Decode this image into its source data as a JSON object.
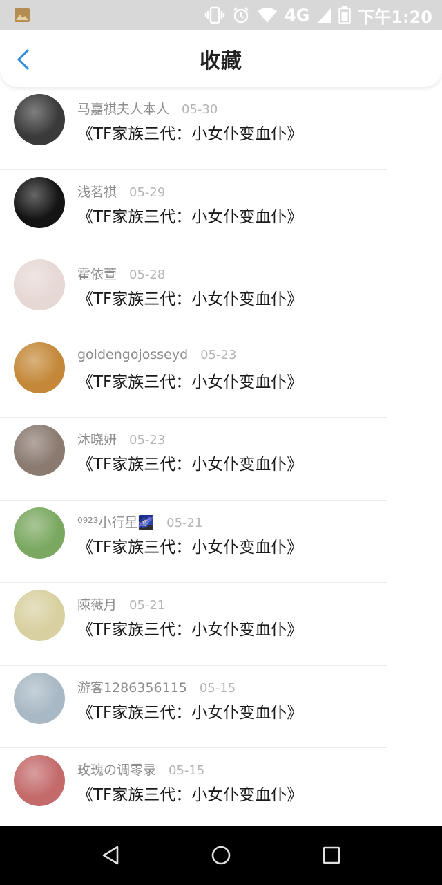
{
  "status_bar": {
    "time": "下午1:20",
    "network": "4G",
    "icons": [
      "image-notification-icon",
      "vibrate-icon",
      "alarm-icon",
      "wifi-icon",
      "signal-icon",
      "battery-icon"
    ]
  },
  "header": {
    "title": "收藏",
    "back_icon": "chevron-left-icon",
    "accent_color": "#2f8ee0"
  },
  "favorites": [
    {
      "user": "马嘉祺夫人本人",
      "date": "05-30",
      "title": "《TF家族三代：小女仆变血仆》",
      "avatar_color": "#3a3a3a"
    },
    {
      "user": "浅茗祺",
      "date": "05-29",
      "title": "《TF家族三代：小女仆变血仆》",
      "avatar_color": "#141414"
    },
    {
      "user": "霍依萱",
      "date": "05-28",
      "title": "《TF家族三代：小女仆变血仆》",
      "avatar_color": "#e6d8d4"
    },
    {
      "user": "goldengojosseyd",
      "date": "05-23",
      "title": "《TF家族三代：小女仆变血仆》",
      "avatar_color": "#c48838"
    },
    {
      "user": "沐晓妍",
      "date": "05-23",
      "title": "《TF家族三代：小女仆变血仆》",
      "avatar_color": "#8a7a70"
    },
    {
      "user": "⁰⁹²³小行星🌌",
      "date": "05-21",
      "title": "《TF家族三代：小女仆变血仆》",
      "avatar_color": "#7aa860"
    },
    {
      "user": "陳薇月",
      "date": "05-21",
      "title": "《TF家族三代：小女仆变血仆》",
      "avatar_color": "#d8d0a0"
    },
    {
      "user": "游客1286356115",
      "date": "05-15",
      "title": "《TF家族三代：小女仆变血仆》",
      "avatar_color": "#a8b8c4"
    },
    {
      "user": "玫瑰の调零录",
      "date": "05-15",
      "title": "《TF家族三代：小女仆变血仆》",
      "avatar_color": "#c46a6a"
    }
  ],
  "nav_bar": {
    "icons": [
      "back-triangle-icon",
      "home-circle-icon",
      "recents-square-icon"
    ]
  }
}
